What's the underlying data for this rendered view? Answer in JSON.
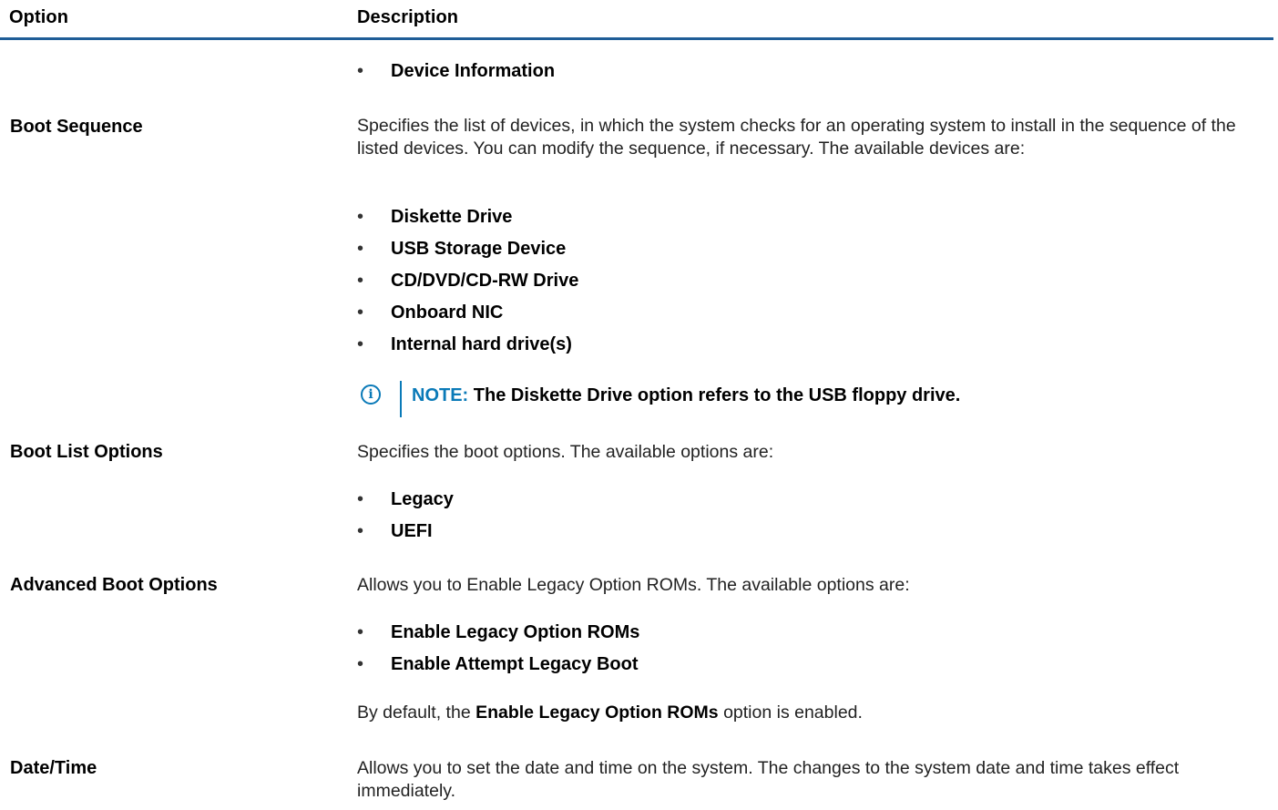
{
  "table": {
    "headers": {
      "option": "Option",
      "description": "Description"
    }
  },
  "rows": {
    "device_info": {
      "bullet": "Device Information"
    },
    "boot_sequence": {
      "option": "Boot Sequence",
      "description": "Specifies the list of devices, in which the system checks for an operating system to install in the sequence of the listed devices. You can modify the sequence, if necessary. The available devices are:",
      "bullets": [
        "Diskette Drive",
        "USB Storage Device",
        "CD/DVD/CD-RW Drive",
        "Onboard NIC",
        "Internal hard drive(s)"
      ],
      "note_label": "NOTE:",
      "note_text": "The Diskette Drive option refers to the USB floppy drive."
    },
    "boot_list_options": {
      "option": "Boot List Options",
      "description": "Specifies the boot options. The available options are:",
      "bullets": [
        "Legacy",
        "UEFI"
      ]
    },
    "advanced_boot_options": {
      "option": "Advanced Boot Options",
      "description": "Allows you to Enable Legacy Option ROMs. The available options are:",
      "bullets": [
        "Enable Legacy Option ROMs",
        "Enable Attempt Legacy Boot"
      ],
      "footer_pre": "By default, the",
      "footer_bold": "Enable Legacy Option ROMs",
      "footer_post": "option is enabled."
    },
    "date_time": {
      "option": "Date/Time",
      "description": "Allows you to set the date and time on the system. The changes to the system date and time takes effect immediately."
    }
  },
  "bullet_char": "•",
  "note_icon": "info-circle-icon",
  "colors": {
    "header_rule": "#1f5d97",
    "note_accent": "#0a7ab8"
  }
}
